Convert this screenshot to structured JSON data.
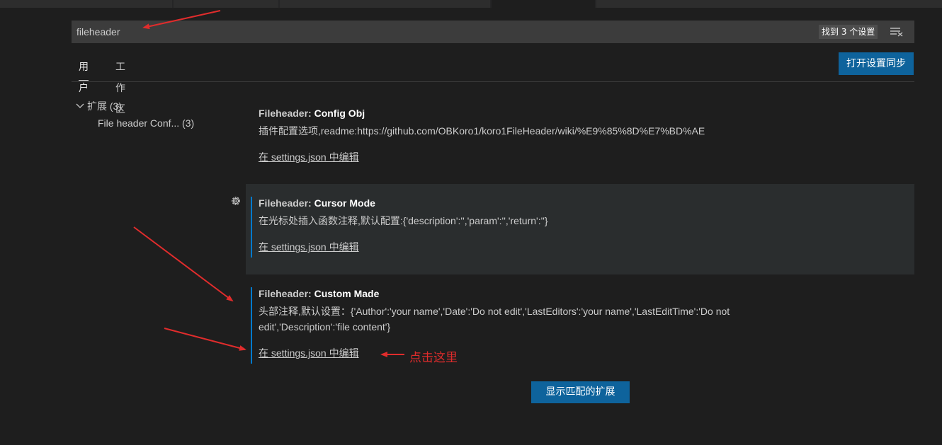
{
  "search": {
    "value": "fileheader",
    "result_count": "找到 3 个设置"
  },
  "tabs": {
    "user": "用户",
    "workspace": "工作区"
  },
  "sync_button": "打开设置同步",
  "tree": {
    "extensions": "扩展 (3)",
    "file_header_config": "File header Conf... (3)"
  },
  "settings": [
    {
      "category": "Fileheader: ",
      "name": "Config Obj",
      "description": "插件配置选项,readme:https://github.com/OBKoro1/koro1FileHeader/wiki/%E9%85%8D%E7%BD%AE",
      "edit_link": "在 settings.json 中编辑"
    },
    {
      "category": "Fileheader: ",
      "name": "Cursor Mode",
      "description": "在光标处插入函数注释,默认配置:{'description':'','param':'','return':''}",
      "edit_link": "在 settings.json 中编辑"
    },
    {
      "category": "Fileheader: ",
      "name": "Custom Made",
      "description": "头部注释,默认设置：{'Author':'your name','Date':'Do not edit','LastEditors':'your name','LastEditTime':'Do not edit','Description':'file content'}",
      "edit_link": "在 settings.json 中编辑"
    }
  ],
  "show_extensions_button": "显示匹配的扩展",
  "annotation": {
    "text": "点击这里",
    "color": "#e02c2c"
  },
  "colors": {
    "background": "#1e1e1e",
    "accent": "#0e639c",
    "focus": "#007acc"
  }
}
